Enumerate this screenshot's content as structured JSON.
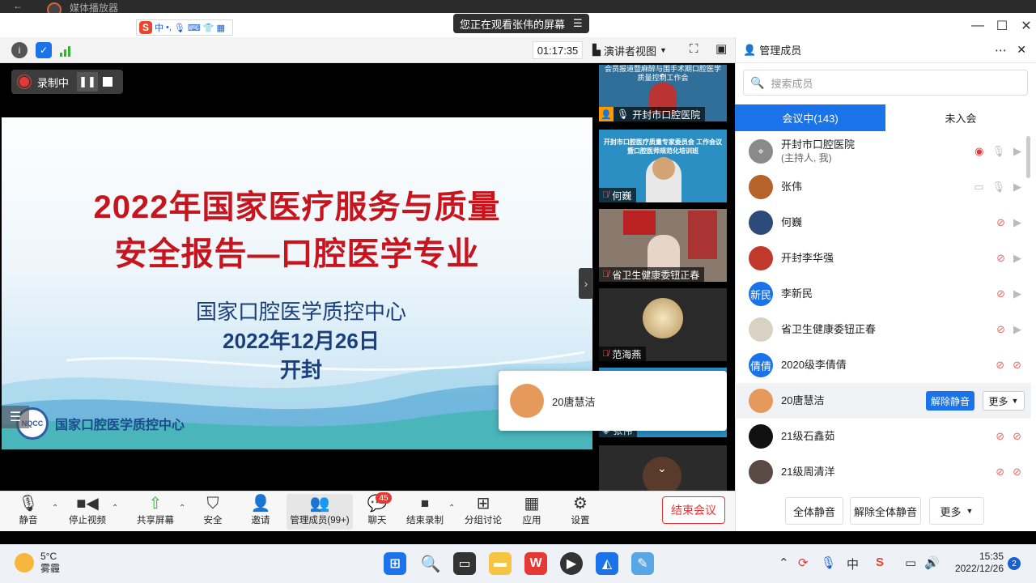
{
  "window": {
    "title": "媒体播放器",
    "share_notice": "您正在观看张伟的屏幕"
  },
  "ime": {
    "zh": "中",
    "punct": "•,"
  },
  "toolbar": {
    "timer": "01:17:35",
    "view_mode": "演讲者视图"
  },
  "recording": {
    "label": "录制中"
  },
  "slide": {
    "title_line1": "2022年国家医疗服务与质量",
    "title_line2": "安全报告—口腔医学专业",
    "org": "国家口腔医学质控中心",
    "date": "2022年12月26日",
    "place": "开封",
    "logo_text": "NQCC",
    "footer_org": "国家口腔医学质控中心"
  },
  "gallery": [
    {
      "name": "开封市口腔医院",
      "banner": "会员报道暨麻醉与围手术期口腔医学质量控制工作会"
    },
    {
      "name": "何巍",
      "banner": "开封市口腔医疗质量专家委员会 工作会议暨口腔医师规范化培训班"
    },
    {
      "name": "省卫生健康委钮正春"
    },
    {
      "name": "范海燕"
    },
    {
      "name": "张伟"
    }
  ],
  "popup": {
    "name": "20唐慧洁"
  },
  "bottom_tools": [
    {
      "label": "静音"
    },
    {
      "label": "停止视频"
    },
    {
      "label": "共享屏幕"
    },
    {
      "label": "安全"
    },
    {
      "label": "邀请"
    },
    {
      "label": "管理成员(99+)"
    },
    {
      "label": "聊天",
      "badge": "45"
    },
    {
      "label": "结束录制"
    },
    {
      "label": "分组讨论"
    },
    {
      "label": "应用"
    },
    {
      "label": "设置"
    }
  ],
  "end_meeting": "结束会议",
  "panel": {
    "title": "管理成员",
    "search_placeholder": "搜索成员",
    "tab_in": "会议中(143)",
    "tab_out": "未入会",
    "members": [
      {
        "name": "开封市口腔医院",
        "sub": "(主持人, 我)",
        "avatar_color": "#8a8a8a"
      },
      {
        "name": "张伟",
        "avatar_color": "#b5632b"
      },
      {
        "name": "何巍",
        "avatar_color": "#2c4a7a"
      },
      {
        "name": "开封李华强",
        "avatar_color": "#c0392b"
      },
      {
        "name": "李新民",
        "avatar_text": "新民",
        "avatar_color": "#1a73e8"
      },
      {
        "name": "省卫生健康委钮正春",
        "avatar_color": "#d9d2c4"
      },
      {
        "name": "2020级李倩倩",
        "avatar_text": "倩倩",
        "avatar_color": "#1a73e8"
      },
      {
        "name": "20唐慧洁",
        "avatar_color": "#e59a5b"
      },
      {
        "name": "21级石鑫茹",
        "avatar_color": "#111111"
      },
      {
        "name": "21级周清洋",
        "avatar_color": "#5a4a44"
      }
    ],
    "unmute_label": "解除静音",
    "more_label": "更多",
    "mute_all": "全体静音",
    "unmute_all": "解除全体静音",
    "more_bottom": "更多"
  },
  "taskbar": {
    "temp": "5°C",
    "weather": "雾霾",
    "time": "15:35",
    "date": "2022/12/26",
    "notifications": "2",
    "ime": "中"
  }
}
